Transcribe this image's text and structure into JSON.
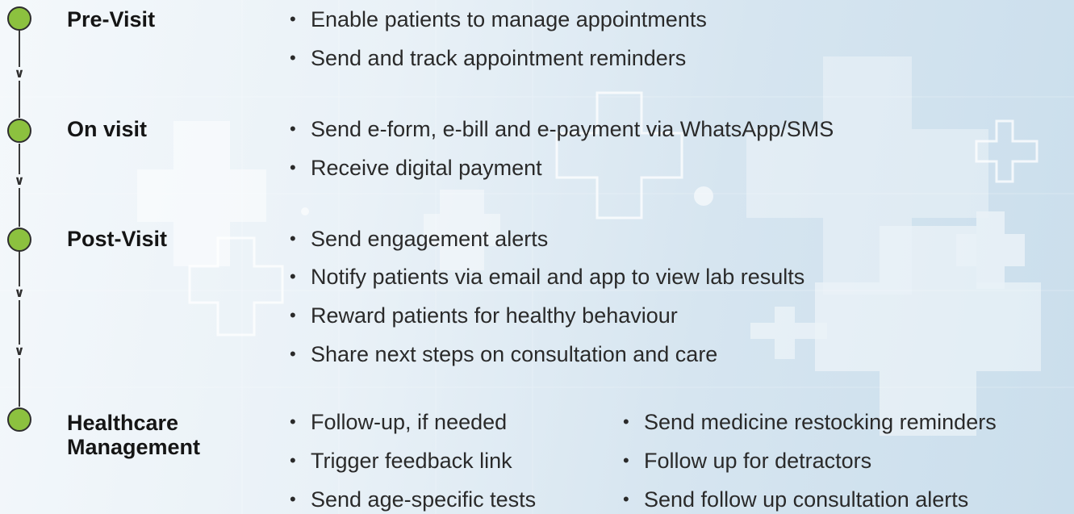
{
  "colors": {
    "node_fill": "#8cc13f",
    "node_stroke": "#2e2e2e",
    "line": "#3a3a3a",
    "text": "#1e1e1e"
  },
  "icons": {
    "node": "circle-node-icon",
    "connector": "chevron-down-icon",
    "background": "medical-cross-icon"
  },
  "stages": [
    {
      "title": "Pre-Visit",
      "items": [
        "Enable patients to manage appointments",
        "Send and track appointment reminders"
      ]
    },
    {
      "title": "On visit",
      "items": [
        "Send e-form, e-bill and e-payment via WhatsApp/SMS",
        "Receive digital payment"
      ]
    },
    {
      "title": "Post-Visit",
      "items": [
        "Send engagement alerts",
        "Notify patients via email and app to view lab results",
        "Reward patients for healthy behaviour",
        "Share next steps on consultation and care"
      ]
    },
    {
      "title": "Healthcare\nManagement",
      "items": [
        "Follow-up, if needed",
        "Trigger feedback link",
        "Send age-specific tests"
      ],
      "items_right": [
        "Send medicine restocking reminders",
        "Follow up for detractors",
        "Send follow up consultation alerts"
      ]
    }
  ]
}
